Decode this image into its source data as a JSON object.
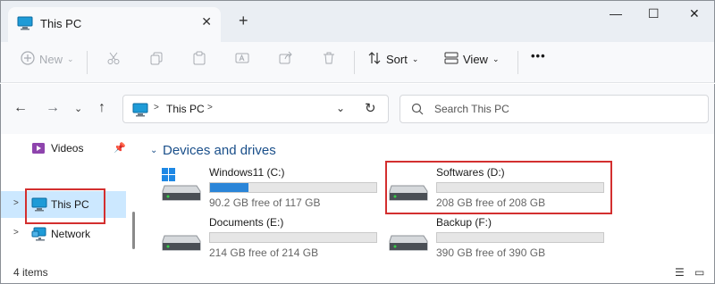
{
  "window": {
    "tab_title": "This PC",
    "new_tab": "+",
    "close_tab": "✕",
    "minimize": "—",
    "maximize": "☐",
    "close": "✕"
  },
  "toolbar": {
    "new_label": "New",
    "sort_label": "Sort",
    "view_label": "View",
    "more": "•••"
  },
  "address": {
    "crumb": "This PC",
    "search_placeholder": "Search This PC"
  },
  "sidebar": {
    "items": [
      {
        "label": "Videos"
      },
      {
        "label": "This PC"
      },
      {
        "label": "Network"
      }
    ]
  },
  "main": {
    "group_title": "Devices and drives",
    "drives": [
      {
        "name": "Windows11 (C:)",
        "free_text": "90.2 GB free of 117 GB",
        "used_fraction": 0.23,
        "system": true
      },
      {
        "name": "Softwares (D:)",
        "free_text": "208 GB free of 208 GB",
        "used_fraction": 0.0,
        "system": false
      },
      {
        "name": "Documents (E:)",
        "free_text": "214 GB free of 214 GB",
        "used_fraction": 0.0,
        "system": false
      },
      {
        "name": "Backup (F:)",
        "free_text": "390 GB free of 390 GB",
        "used_fraction": 0.0,
        "system": false
      }
    ]
  },
  "status": {
    "item_count": "4 items"
  },
  "colors": {
    "accent": "#2a85d8",
    "highlight": "#d32f2f",
    "selection": "#cce8ff",
    "group_title": "#1a4f8a"
  }
}
